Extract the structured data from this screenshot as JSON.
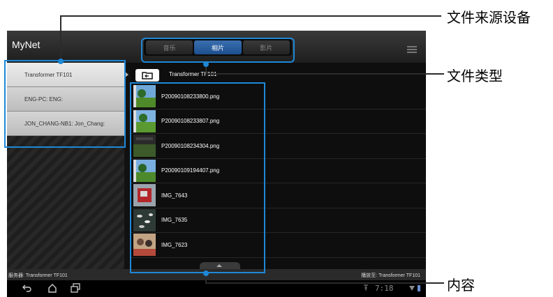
{
  "app": {
    "title": "MyNet"
  },
  "tabs": [
    {
      "label": "音乐",
      "active": false
    },
    {
      "label": "相片",
      "active": true
    },
    {
      "label": "影片",
      "active": false
    }
  ],
  "sources": [
    {
      "label": "Transformer TF101",
      "selected": true
    },
    {
      "label": "ENG-PC: ENG:",
      "selected": false
    },
    {
      "label": "JON_CHANG-NB1: Jon_Chang:",
      "selected": false
    }
  ],
  "breadcrumb": {
    "label": "Transformer TF101"
  },
  "files": [
    {
      "name": "P20090108233800.png",
      "thumb": "landscape"
    },
    {
      "name": "P20090108233807.png",
      "thumb": "landscape"
    },
    {
      "name": "P20090108234304.png",
      "thumb": "dark"
    },
    {
      "name": "P20090109194407.png",
      "thumb": "landscape"
    },
    {
      "name": "IMG_7643",
      "thumb": "photo-red"
    },
    {
      "name": "IMG_7635",
      "thumb": "photo-leaves"
    },
    {
      "name": "IMG_7623",
      "thumb": "photo-people"
    }
  ],
  "status": {
    "server": "服务器: Transformer TF101",
    "player": "播放至: Transformer TF101"
  },
  "systembar": {
    "time": "7:18"
  },
  "callouts": {
    "source": "文件来源设备",
    "type": "文件类型",
    "content": "内容"
  },
  "colors": {
    "highlight": "#1e88d8",
    "activeTab": "#2a5e9f"
  }
}
